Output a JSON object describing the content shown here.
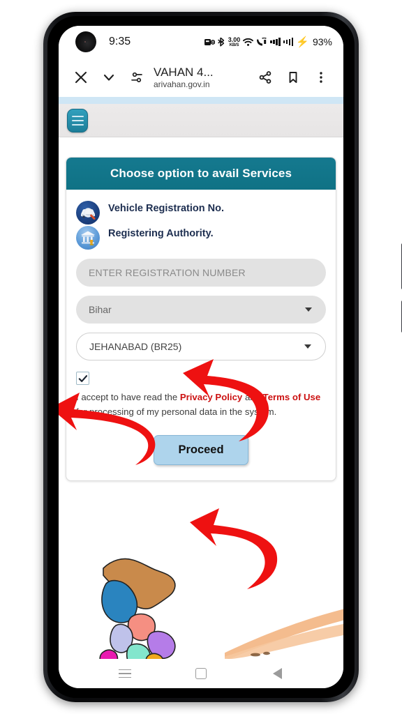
{
  "status_bar": {
    "time": "9:35",
    "net_speed_value": "3.00",
    "net_speed_unit": "KB/S",
    "battery_percent": "93%",
    "icons": [
      "vibrate-icon",
      "bluetooth-icon",
      "net-speed-icon",
      "wifi-icon",
      "call-wifi-icon",
      "signal-bars-sim1-icon",
      "signal-bars-sim2-icon",
      "charging-bolt-icon"
    ]
  },
  "browser": {
    "close_label": "close-icon",
    "collapse_label": "chevron-down-icon",
    "tune_label": "page-info-icon",
    "title": "VAHAN 4...",
    "url": "arivahan.gov.in",
    "share_label": "share-icon",
    "bookmark_label": "bookmark-icon",
    "menu_label": "overflow-menu-icon"
  },
  "page": {
    "menu_button": "hamburger-menu",
    "card": {
      "header": "Choose option to avail Services",
      "options": [
        {
          "icon": "vehicle-registration-icon",
          "label": "Vehicle Registration No."
        },
        {
          "icon": "registering-authority-icon",
          "label": "Registering Authority."
        }
      ],
      "registration_input": {
        "value": "",
        "placeholder": "ENTER REGISTRATION NUMBER"
      },
      "state_select": {
        "value": "Bihar",
        "caret": "chevron-down-icon"
      },
      "rto_select": {
        "value": "JEHANABAD (BR25)",
        "caret": "chevron-down-icon"
      },
      "consent": {
        "checked": true,
        "text_part1": "I accept to have read the ",
        "link1": "Privacy Policy",
        "text_part2": " and ",
        "link2": "Terms of Use",
        "text_part3": " for processing of my personal data in the system."
      },
      "proceed_label": "Proceed"
    },
    "decorations": {
      "map": "india-map-illustration",
      "swoosh": "orange-curve-decoration"
    }
  },
  "annotations": {
    "arrow_1": "red-arrow-pointing-to-rto-dropdown",
    "arrow_2": "red-arrow-pointing-to-consent-checkbox",
    "arrow_3": "red-arrow-pointing-to-proceed-button",
    "color": "#ee1111"
  },
  "nav_bar": {
    "recents": "recents-icon",
    "home": "home-icon",
    "back": "back-icon"
  },
  "colors": {
    "card_header_teal": "#0f7285",
    "proceed_blue": "#aed4ec",
    "link_red": "#cc1111",
    "annotation_red": "#ee1111",
    "page_strip_blue": "#cfe6f5"
  }
}
